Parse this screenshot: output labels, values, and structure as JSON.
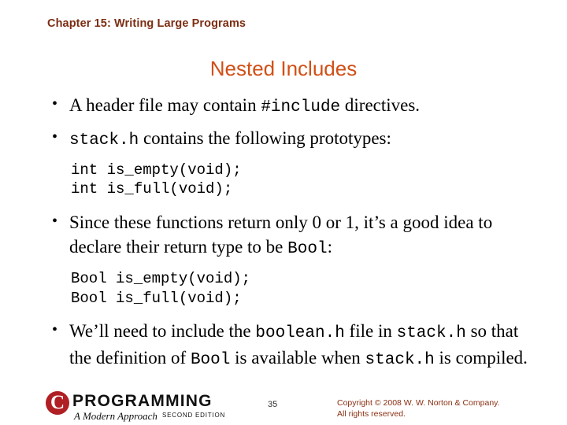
{
  "header": {
    "chapter": "Chapter 15: Writing Large Programs",
    "chapter_color": "#7b2d12"
  },
  "title": {
    "text": "Nested Includes",
    "color": "#d14f16"
  },
  "bullets": [
    {
      "marker": "•",
      "segments": [
        {
          "text": "A header file may contain ",
          "style": "normal"
        },
        {
          "text": "#include",
          "style": "mono"
        },
        {
          "text": " directives.",
          "style": "normal"
        }
      ]
    },
    {
      "marker": "•",
      "segments": [
        {
          "text": "stack.h",
          "style": "mono"
        },
        {
          "text": " contains the following prototypes:",
          "style": "normal"
        }
      ]
    },
    {
      "marker": "•",
      "segments": [
        {
          "text": "Since these functions return only 0 or 1, it’s a good idea to declare their return type to be ",
          "style": "normal"
        },
        {
          "text": "Bool",
          "style": "mono"
        },
        {
          "text": ":",
          "style": "normal"
        }
      ]
    },
    {
      "marker": "•",
      "segments": [
        {
          "text": "We’ll need to include the ",
          "style": "normal"
        },
        {
          "text": "boolean.h",
          "style": "mono"
        },
        {
          "text": " file in ",
          "style": "normal"
        },
        {
          "text": "stack.h",
          "style": "mono"
        },
        {
          "text": " so that the definition of ",
          "style": "normal"
        },
        {
          "text": "Bool",
          "style": "mono"
        },
        {
          "text": " is available when ",
          "style": "normal"
        },
        {
          "text": "stack.h",
          "style": "mono"
        },
        {
          "text": " is compiled.",
          "style": "normal"
        }
      ]
    }
  ],
  "code_blocks": {
    "first": "int is_empty(void);\nint is_full(void);",
    "second": "Bool is_empty(void);\nBool is_full(void);"
  },
  "footer": {
    "logo_letter": "C",
    "logo_word": "PROGRAMMING",
    "logo_subtitle": "A Modern Approach",
    "logo_edition": "SECOND EDITION",
    "page_number": "35",
    "copyright_line1": "Copyright © 2008 W. W. Norton & Company.",
    "copyright_line2": "All rights reserved.",
    "copyright_color": "#8a2f12"
  }
}
